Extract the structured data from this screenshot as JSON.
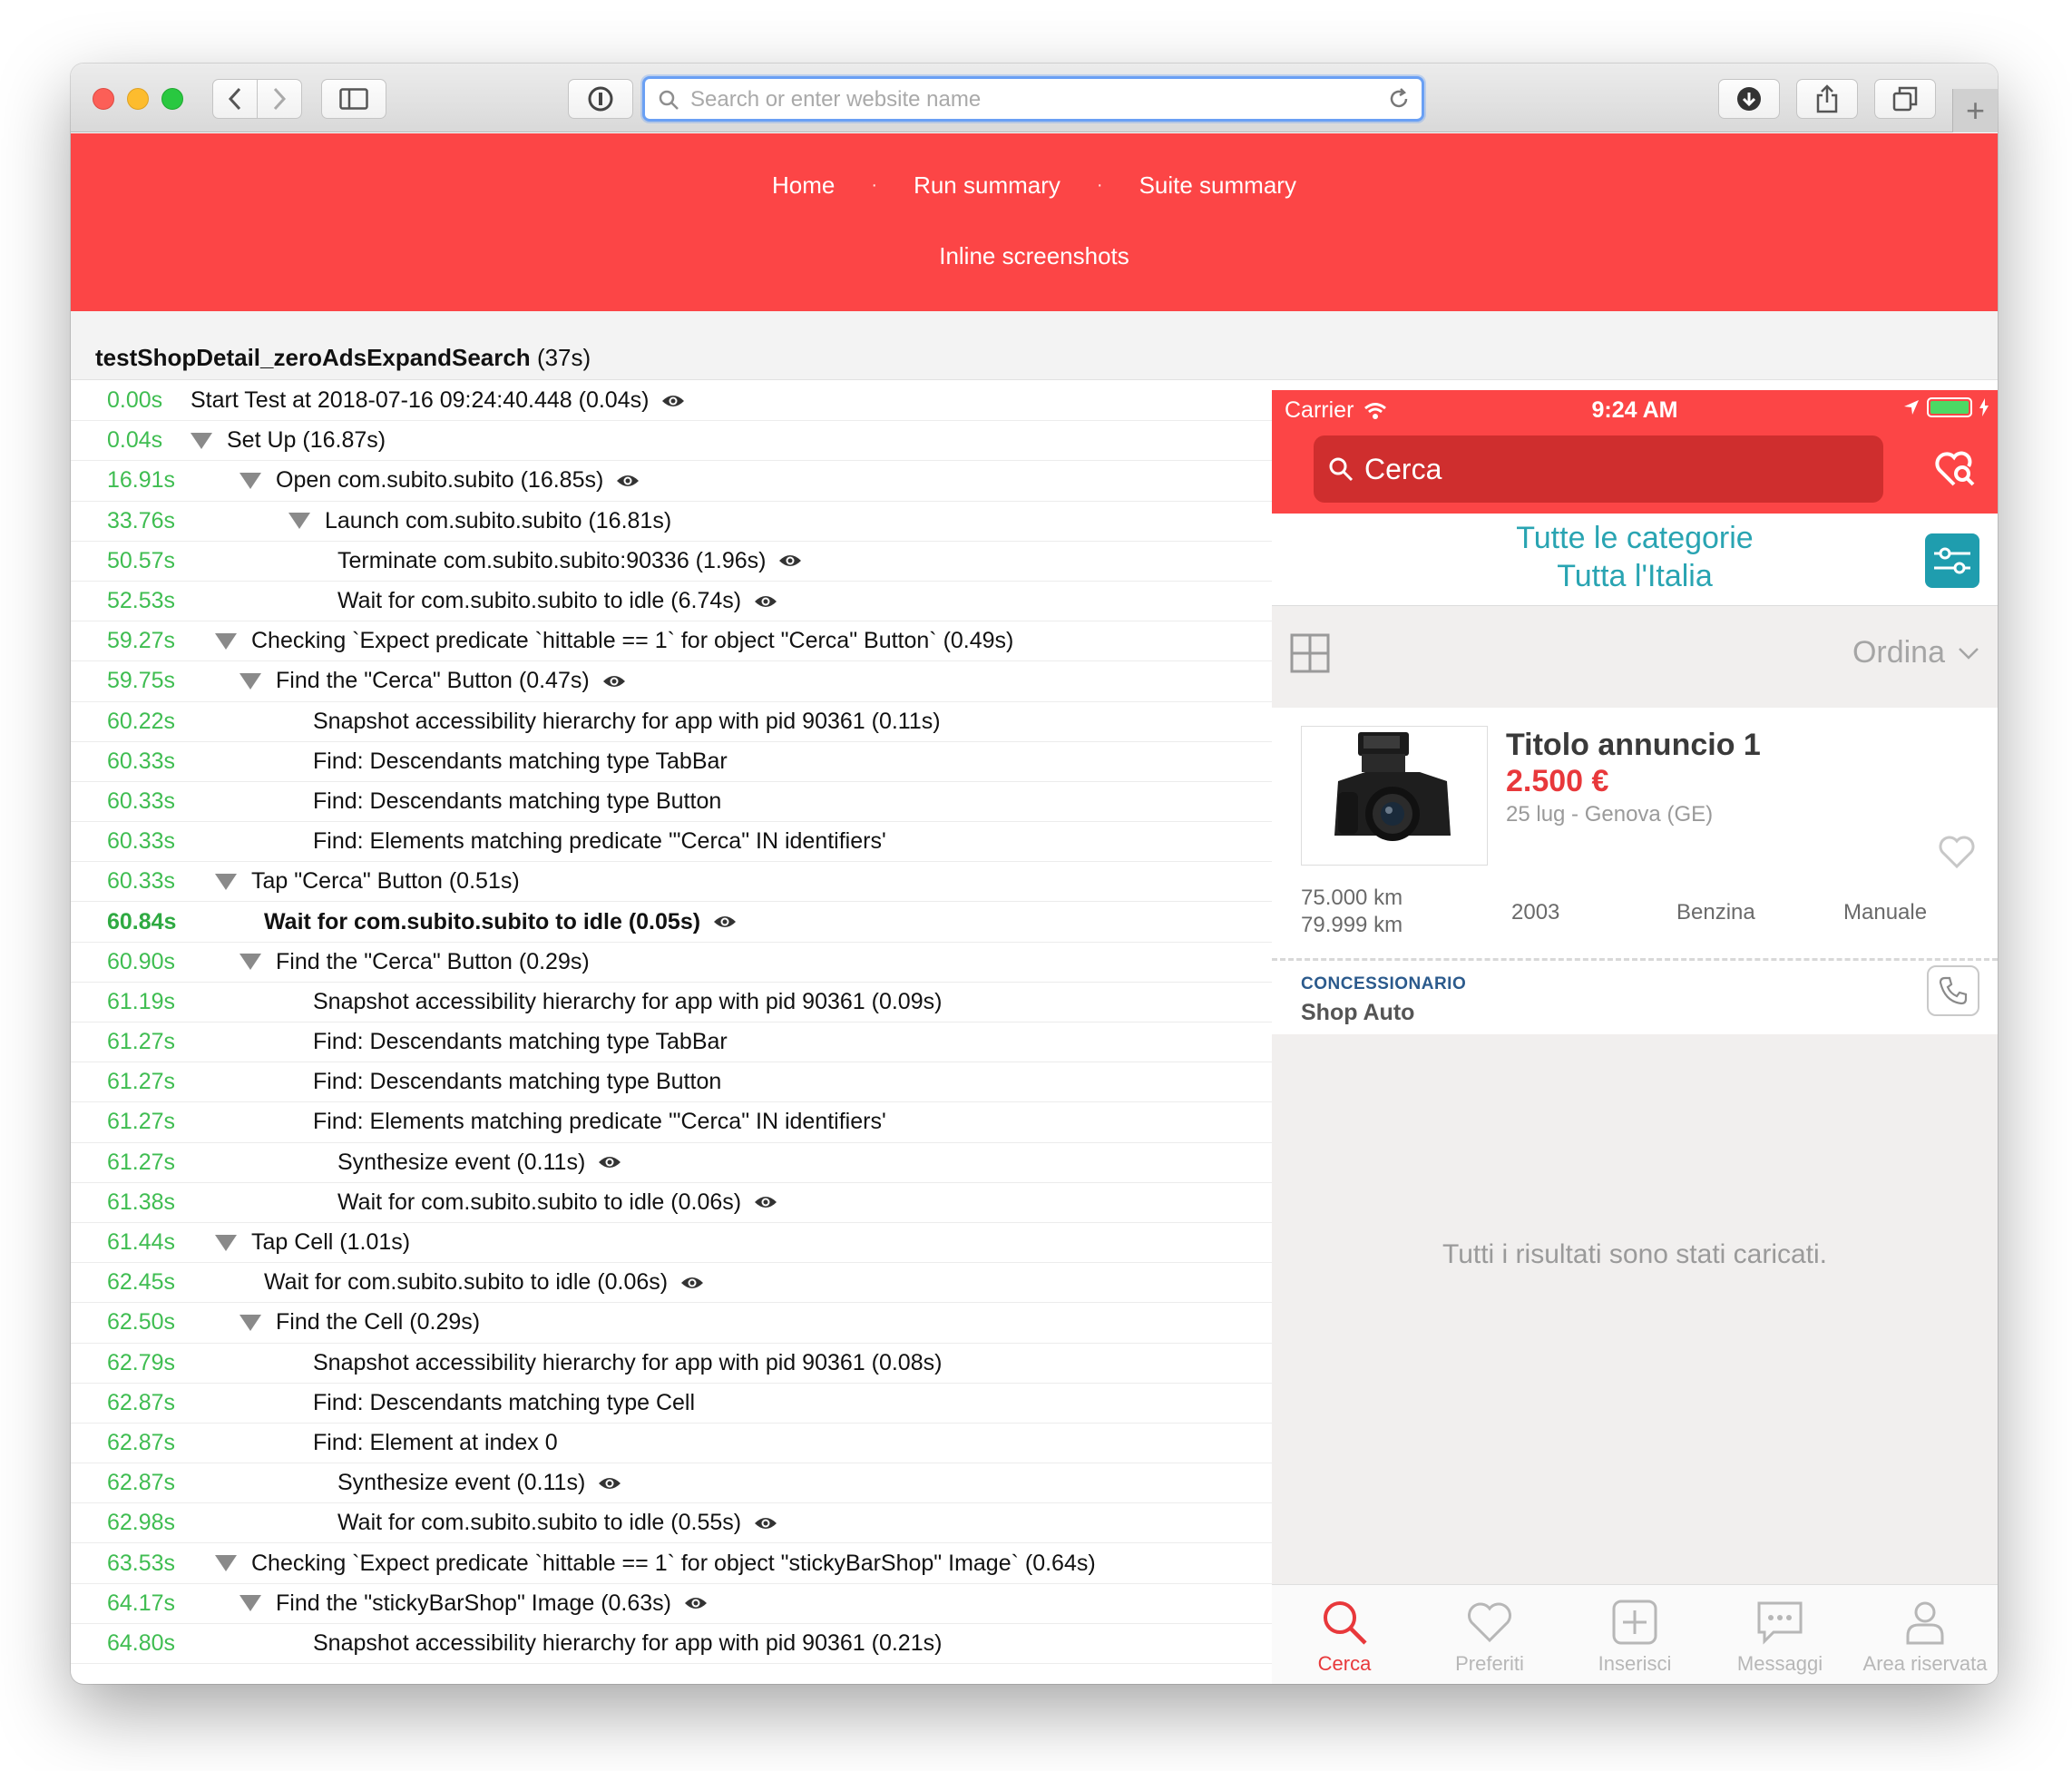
{
  "browser": {
    "url_placeholder": "Search or enter website name",
    "url_value": ""
  },
  "nav": {
    "links": [
      "Home",
      "Run summary",
      "Suite summary",
      "Inline screenshots"
    ],
    "separator": "·"
  },
  "test": {
    "name": "testShopDetail_zeroAdsExpandSearch",
    "duration": "(37s)"
  },
  "log_rows": [
    {
      "time": "0.00s",
      "indent": 0,
      "toggle": false,
      "text": "Start Test at 2018-07-16 09:24:40.448 (0.04s)",
      "eye": true,
      "bold": false
    },
    {
      "time": "0.04s",
      "indent": 0,
      "toggle": true,
      "text": "Set Up (16.87s)",
      "eye": false,
      "bold": false
    },
    {
      "time": "16.91s",
      "indent": 1,
      "toggle": true,
      "text": "Open com.subito.subito (16.85s)",
      "eye": true,
      "bold": false
    },
    {
      "time": "33.76s",
      "indent": 2,
      "toggle": true,
      "text": "Launch com.subito.subito (16.81s)",
      "eye": false,
      "bold": false
    },
    {
      "time": "50.57s",
      "indent": 3,
      "toggle": false,
      "text": "Terminate com.subito.subito:90336 (1.96s)",
      "eye": true,
      "bold": false
    },
    {
      "time": "52.53s",
      "indent": 3,
      "toggle": false,
      "text": "Wait for com.subito.subito to idle (6.74s)",
      "eye": true,
      "bold": false
    },
    {
      "time": "59.27s",
      "indent": 0.5,
      "toggle": true,
      "text": "Checking `Expect predicate `hittable == 1` for object \"Cerca\" Button` (0.49s)",
      "eye": false,
      "bold": false
    },
    {
      "time": "59.75s",
      "indent": 1,
      "toggle": true,
      "text": "Find the \"Cerca\" Button (0.47s)",
      "eye": true,
      "bold": false
    },
    {
      "time": "60.22s",
      "indent": 2.5,
      "toggle": false,
      "text": "Snapshot accessibility hierarchy for app with pid 90361 (0.11s)",
      "eye": false,
      "bold": false
    },
    {
      "time": "60.33s",
      "indent": 2.5,
      "toggle": false,
      "text": "Find: Descendants matching type TabBar",
      "eye": false,
      "bold": false
    },
    {
      "time": "60.33s",
      "indent": 2.5,
      "toggle": false,
      "text": "Find: Descendants matching type Button",
      "eye": false,
      "bold": false
    },
    {
      "time": "60.33s",
      "indent": 2.5,
      "toggle": false,
      "text": "Find: Elements matching predicate '\"Cerca\" IN identifiers'",
      "eye": false,
      "bold": false
    },
    {
      "time": "60.33s",
      "indent": 0.5,
      "toggle": true,
      "text": "Tap \"Cerca\" Button (0.51s)",
      "eye": false,
      "bold": false
    },
    {
      "time": "60.84s",
      "indent": 1.5,
      "toggle": false,
      "text": "Wait for com.subito.subito to idle (0.05s)",
      "eye": true,
      "bold": true
    },
    {
      "time": "60.90s",
      "indent": 1,
      "toggle": true,
      "text": "Find the \"Cerca\" Button (0.29s)",
      "eye": false,
      "bold": false
    },
    {
      "time": "61.19s",
      "indent": 2.5,
      "toggle": false,
      "text": "Snapshot accessibility hierarchy for app with pid 90361 (0.09s)",
      "eye": false,
      "bold": false
    },
    {
      "time": "61.27s",
      "indent": 2.5,
      "toggle": false,
      "text": "Find: Descendants matching type TabBar",
      "eye": false,
      "bold": false
    },
    {
      "time": "61.27s",
      "indent": 2.5,
      "toggle": false,
      "text": "Find: Descendants matching type Button",
      "eye": false,
      "bold": false
    },
    {
      "time": "61.27s",
      "indent": 2.5,
      "toggle": false,
      "text": "Find: Elements matching predicate '\"Cerca\" IN identifiers'",
      "eye": false,
      "bold": false
    },
    {
      "time": "61.27s",
      "indent": 3,
      "toggle": false,
      "text": "Synthesize event (0.11s)",
      "eye": true,
      "bold": false
    },
    {
      "time": "61.38s",
      "indent": 3,
      "toggle": false,
      "text": "Wait for com.subito.subito to idle (0.06s)",
      "eye": true,
      "bold": false
    },
    {
      "time": "61.44s",
      "indent": 0.5,
      "toggle": true,
      "text": "Tap Cell (1.01s)",
      "eye": false,
      "bold": false
    },
    {
      "time": "62.45s",
      "indent": 1.5,
      "toggle": false,
      "text": "Wait for com.subito.subito to idle (0.06s)",
      "eye": true,
      "bold": false
    },
    {
      "time": "62.50s",
      "indent": 1,
      "toggle": true,
      "text": "Find the Cell (0.29s)",
      "eye": false,
      "bold": false
    },
    {
      "time": "62.79s",
      "indent": 2.5,
      "toggle": false,
      "text": "Snapshot accessibility hierarchy for app with pid 90361 (0.08s)",
      "eye": false,
      "bold": false
    },
    {
      "time": "62.87s",
      "indent": 2.5,
      "toggle": false,
      "text": "Find: Descendants matching type Cell",
      "eye": false,
      "bold": false
    },
    {
      "time": "62.87s",
      "indent": 2.5,
      "toggle": false,
      "text": "Find: Element at index 0",
      "eye": false,
      "bold": false
    },
    {
      "time": "62.87s",
      "indent": 3,
      "toggle": false,
      "text": "Synthesize event (0.11s)",
      "eye": true,
      "bold": false
    },
    {
      "time": "62.98s",
      "indent": 3,
      "toggle": false,
      "text": "Wait for com.subito.subito to idle (0.55s)",
      "eye": true,
      "bold": false
    },
    {
      "time": "63.53s",
      "indent": 0.5,
      "toggle": true,
      "text": "Checking `Expect predicate `hittable == 1` for object \"stickyBarShop\" Image` (0.64s)",
      "eye": false,
      "bold": false
    },
    {
      "time": "64.17s",
      "indent": 1,
      "toggle": true,
      "text": "Find the \"stickyBarShop\" Image (0.63s)",
      "eye": true,
      "bold": false
    },
    {
      "time": "64.80s",
      "indent": 2.5,
      "toggle": false,
      "text": "Snapshot accessibility hierarchy for app with pid 90361 (0.21s)",
      "eye": false,
      "bold": false
    }
  ],
  "phone": {
    "carrier": "Carrier",
    "time": "9:24 AM",
    "search_placeholder": "Cerca",
    "categories": "Tutte le categorie",
    "location": "Tutta l'Italia",
    "sort_label": "Ordina",
    "ad": {
      "title": "Titolo annuncio 1",
      "price": "2.500 €",
      "meta": "25 lug - Genova (GE)",
      "km_from": "75.000 km",
      "km_to": "79.999 km",
      "year": "2003",
      "fuel": "Benzina",
      "gearbox": "Manuale",
      "dealer_type": "CONCESSIONARIO",
      "dealer_name": "Shop Auto"
    },
    "loaded_message": "Tutti i risultati sono stati caricati.",
    "tabs": [
      "Cerca",
      "Preferiti",
      "Inserisci",
      "Messaggi",
      "Area riservata"
    ],
    "active_tab": "Cerca"
  },
  "colors": {
    "brand_red": "#fc4546",
    "time_green": "#3fbd51",
    "teal": "#29a4b2",
    "price_red": "#e8383b"
  }
}
